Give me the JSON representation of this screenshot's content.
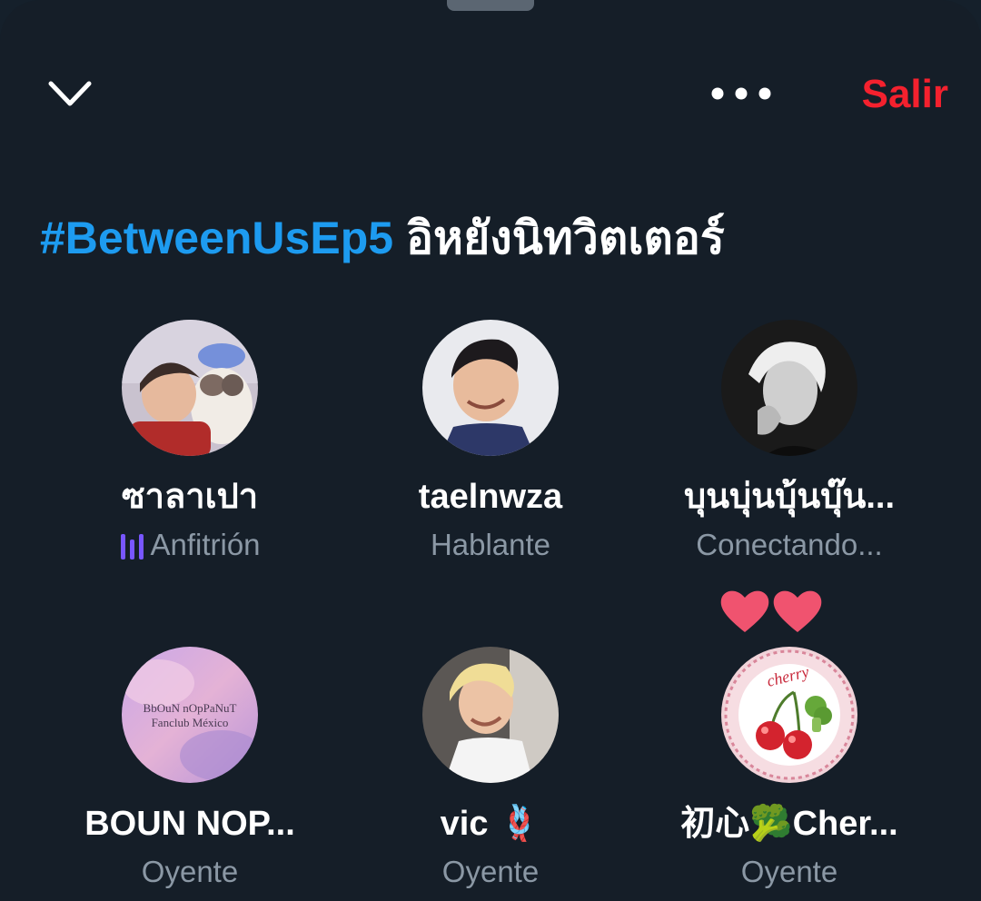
{
  "header": {
    "collapse_icon": "chevron-down-icon",
    "more_icon": "more-horizontal-icon",
    "leave_label": "Salir",
    "leave_color": "#f4212e"
  },
  "space": {
    "hashtag": "#BetweenUsEp5",
    "title_text": "อิหยังนิทวิตเตอร์",
    "hashtag_color": "#1d9bf0"
  },
  "participants": [
    {
      "name": "ซาลาเปา",
      "role": "Anfitrión",
      "role_icon": "speaking-bars-icon"
    },
    {
      "name": "taelnwza",
      "role": "Hablante"
    },
    {
      "name": "บุนบุ่นบุ้นบุ๊น...",
      "role": "Conectando..."
    },
    {
      "name": "BOUN NOP...",
      "role": "Oyente",
      "avatar_text": [
        "BbOuN nOpPaNuT",
        "Fanclub México"
      ]
    },
    {
      "name": "vic 🪢",
      "role": "Oyente"
    },
    {
      "name": "初心🥦Cher...",
      "role": "Oyente",
      "avatar_text": [
        "cherry"
      ],
      "reaction": "two-hearts-icon"
    }
  ],
  "colors": {
    "background": "#151e28",
    "text_primary": "#ffffff",
    "text_secondary": "#8b98a5",
    "speaking_accent": "#7856ff",
    "heart": "#f0536f"
  }
}
